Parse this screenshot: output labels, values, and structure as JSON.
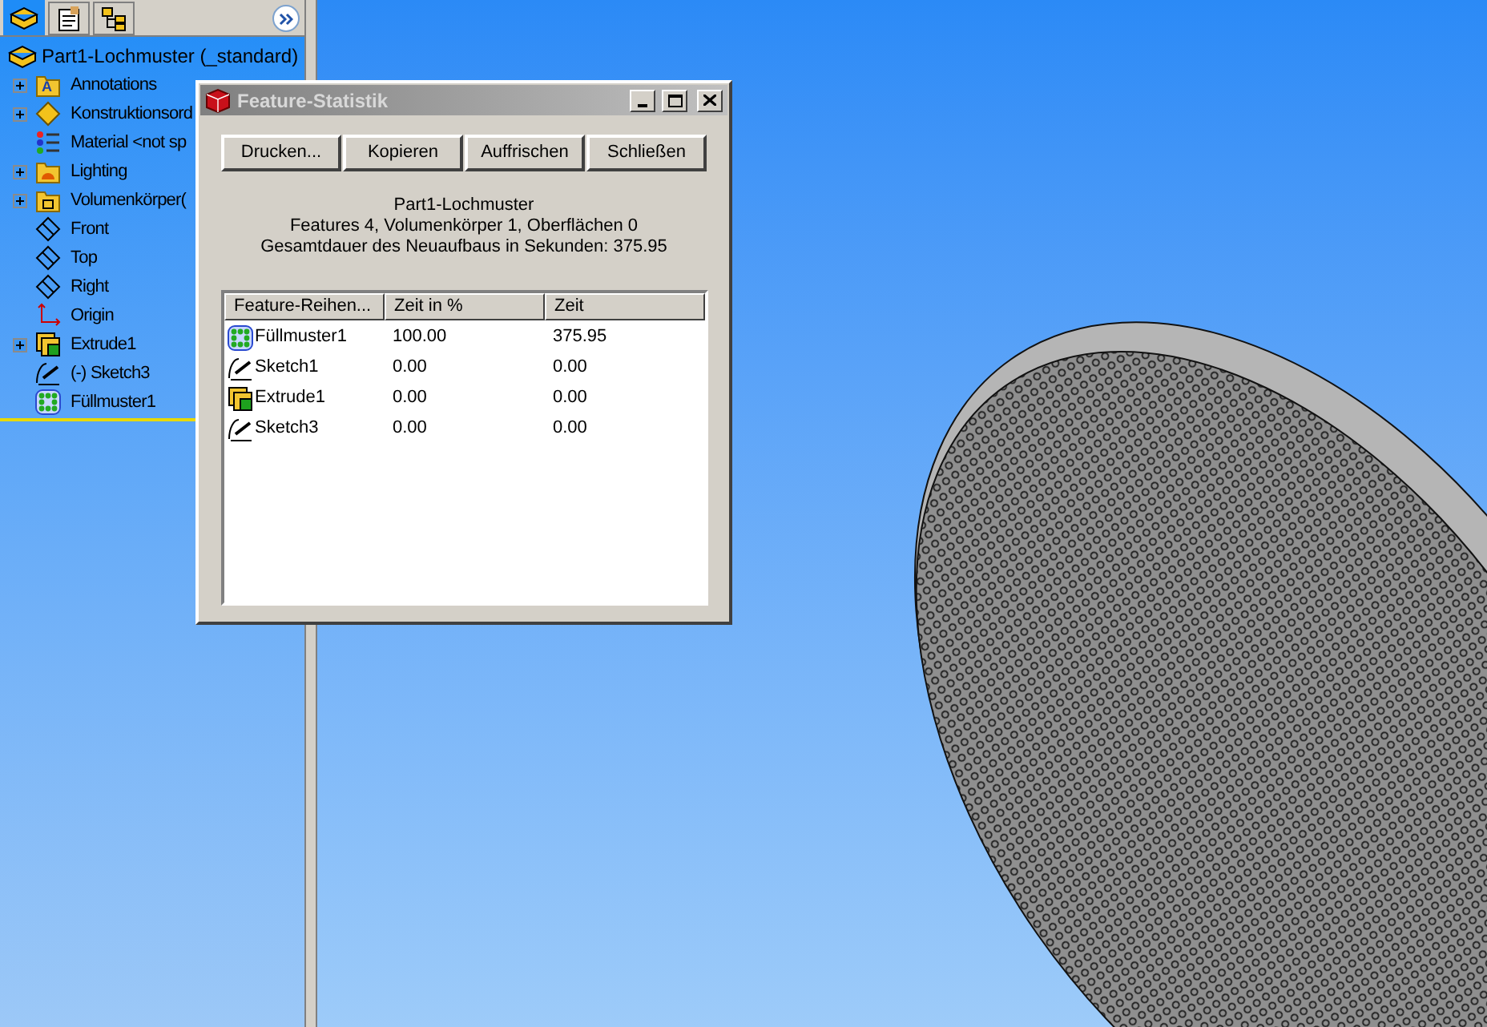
{
  "tree": {
    "root": {
      "label": "Part1-Lochmuster  (_standard)"
    },
    "items": [
      {
        "label": "Annotations",
        "kind": "annotations",
        "icon_text": "A",
        "collapsed": true
      },
      {
        "label": "Konstruktionsord",
        "kind": "design",
        "collapsed": true
      },
      {
        "label": "Material <not sp",
        "kind": "material",
        "collapsed": false
      },
      {
        "label": "Lighting",
        "kind": "lighting",
        "collapsed": true
      },
      {
        "label": "Volumenkörper(",
        "kind": "solid",
        "collapsed": true
      },
      {
        "label": "Front",
        "kind": "plane",
        "collapsed": false
      },
      {
        "label": "Top",
        "kind": "plane",
        "collapsed": false
      },
      {
        "label": "Right",
        "kind": "plane",
        "collapsed": false
      },
      {
        "label": "Origin",
        "kind": "origin",
        "collapsed": false
      },
      {
        "label": "Extrude1",
        "kind": "extrude",
        "collapsed": true
      },
      {
        "label": "(-) Sketch3",
        "kind": "sketch",
        "collapsed": false
      },
      {
        "label": "Füllmuster1",
        "kind": "pattern",
        "collapsed": false
      }
    ]
  },
  "dialog": {
    "title": "Feature-Statistik",
    "buttons": [
      "Drucken...",
      "Kopieren",
      "Auffrischen",
      "Schließen"
    ],
    "summary": [
      "Part1-Lochmuster",
      "Features 4, Volumenkörper 1, Oberflächen 0",
      "Gesamtdauer des Neuaufbaus in Sekunden: 375.95"
    ],
    "table": {
      "columns": [
        "Feature-Reihen...",
        "Zeit in %",
        "Zeit"
      ],
      "rows": [
        {
          "kind": "pattern",
          "cells": [
            "Füllmuster1",
            "100.00",
            "375.95"
          ]
        },
        {
          "kind": "sketch",
          "cells": [
            "Sketch1",
            "0.00",
            "0.00"
          ]
        },
        {
          "kind": "extrude",
          "cells": [
            "Extrude1",
            "0.00",
            "0.00"
          ]
        },
        {
          "kind": "sketch",
          "cells": [
            "Sketch3",
            "0.00",
            "0.00"
          ]
        }
      ]
    }
  }
}
